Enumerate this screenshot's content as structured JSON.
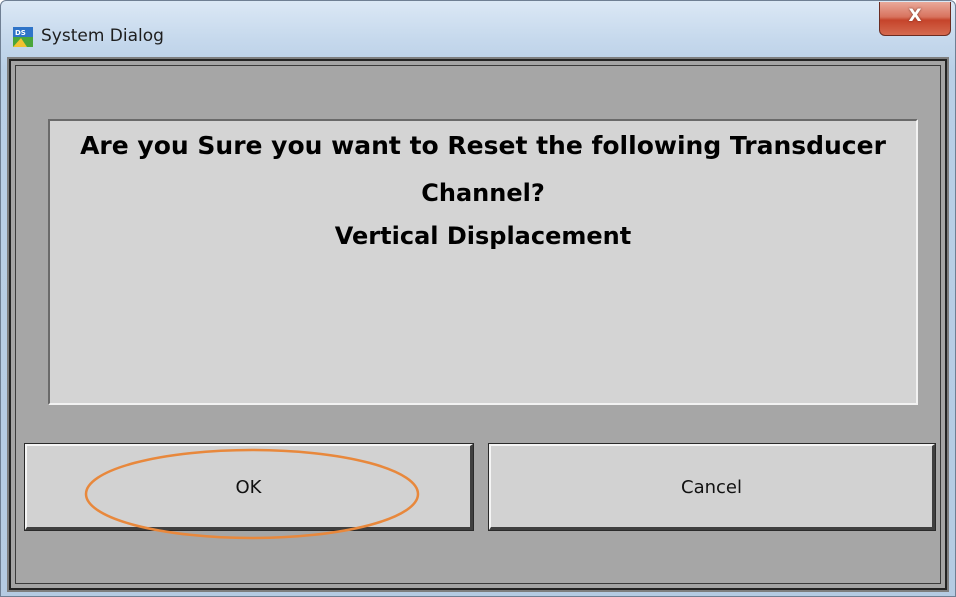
{
  "window": {
    "title": "System Dialog",
    "app_icon": "ds-app-icon",
    "close_glyph": "X"
  },
  "dialog": {
    "message_lines": [
      "Are you Sure you want to Reset the following Transducer",
      "Channel?",
      "Vertical Displacement"
    ],
    "ok_label": "OK",
    "cancel_label": "Cancel"
  },
  "annotation": {
    "highlight_color": "#e8883c",
    "target": "ok-button"
  }
}
